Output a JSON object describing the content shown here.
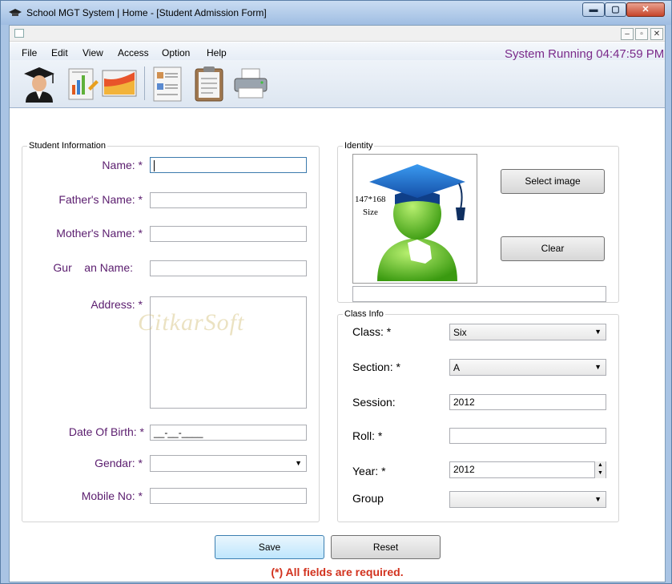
{
  "window": {
    "title": "School MGT System | Home - [Student Admission Form]",
    "min_glyph": "▬",
    "max_glyph": "▢",
    "close_glyph": "✕"
  },
  "mdi": {
    "min_glyph": "–",
    "restore_glyph": "▫",
    "close_glyph": "✕"
  },
  "menu": {
    "items": [
      "File",
      "Edit",
      "View",
      "Access",
      "Option",
      "Help"
    ]
  },
  "status": {
    "running_text": "System Running 04:47:59 PM"
  },
  "toolbar": {
    "icons": [
      "student-icon",
      "report-icon",
      "chart-icon",
      "document-icon",
      "clipboard-icon",
      "printer-icon"
    ]
  },
  "student_info": {
    "title": "Student Information",
    "name_label": "Name: *",
    "name_value": "",
    "father_label": "Father's Name: *",
    "father_value": "",
    "mother_label": "Mother's Name: *",
    "mother_value": "",
    "guardian_label": "Gur    an Name:",
    "guardian_value": "",
    "address_label": "Address: *",
    "address_value": "",
    "dob_label": "Date Of Birth: *",
    "dob_value": "__-__-____",
    "gender_label": "Gendar: *",
    "gender_value": "",
    "mobile_label": "Mobile No: *",
    "mobile_value": ""
  },
  "identity": {
    "title": "Identity",
    "photo_size_text": "147*168",
    "photo_size_sub": "Size",
    "select_image_label": "Select image",
    "clear_label": "Clear",
    "path_value": ""
  },
  "class_info": {
    "title": "Class Info",
    "class_label": "Class: *",
    "class_value": "Six",
    "section_label": "Section: *",
    "section_value": "A",
    "session_label": "Session:",
    "session_value": "2012",
    "roll_label": "Roll: *",
    "roll_value": "",
    "year_label": "Year: *",
    "year_value": "2012",
    "group_label": "Group",
    "group_value": ""
  },
  "watermark": "CitkarSoft",
  "actions": {
    "save_label": "Save",
    "reset_label": "Reset",
    "required_note": "(*) All fields are required."
  },
  "colors": {
    "label_purple": "#5a1c6e",
    "status_purple": "#7a2a8a",
    "required_red": "#d2321e",
    "cap_blue": "#1f6fc8",
    "avatar_green": "#4fc21c"
  }
}
